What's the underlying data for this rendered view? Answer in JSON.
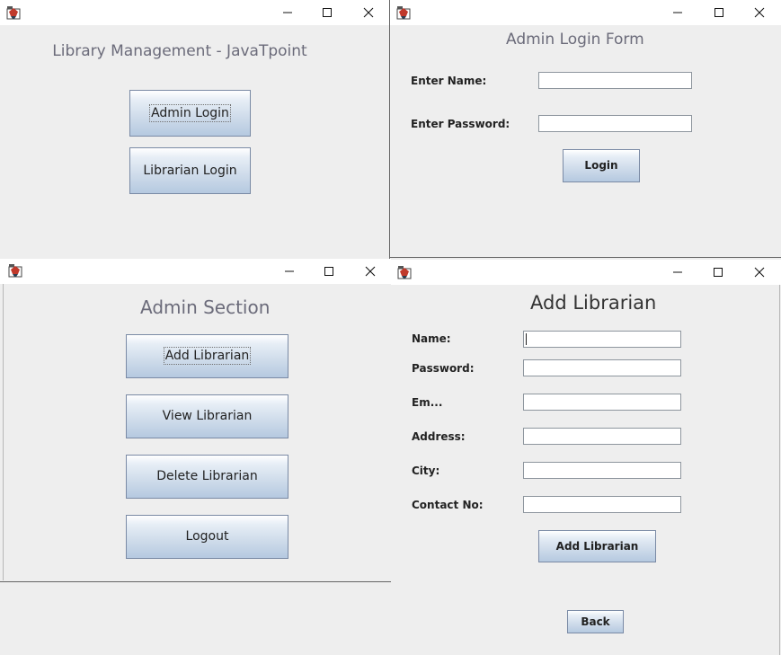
{
  "windows": {
    "main": {
      "title": "Library Management - JavaTpoint",
      "admin_login_label": "Admin Login",
      "librarian_login_label": "Librarian Login"
    },
    "admin_login_form": {
      "title": "Admin Login Form",
      "name_label": "Enter Name:",
      "name_value": "",
      "password_label": "Enter Password:",
      "password_value": "",
      "login_label": "Login"
    },
    "admin_section": {
      "title": "Admin Section",
      "add_label": "Add Librarian",
      "view_label": "View Librarian",
      "delete_label": "Delete Librarian",
      "logout_label": "Logout"
    },
    "add_librarian": {
      "title": "Add Librarian",
      "name_label": "Name:",
      "password_label": "Password:",
      "email_label": "Em...",
      "address_label": "Address:",
      "city_label": "City:",
      "contact_label": "Contact No:",
      "submit_label": "Add Librarian",
      "back_label": "Back"
    }
  },
  "icons": {
    "app": "java-coffee-cup-icon",
    "minimize": "minimize-icon",
    "maximize": "maximize-icon",
    "close": "close-icon"
  },
  "colors": {
    "window_bg": "#eeeeee",
    "titlebar_bg": "#ffffff",
    "button_border": "#7a8aa5",
    "title_text": "#6b6b7a"
  }
}
